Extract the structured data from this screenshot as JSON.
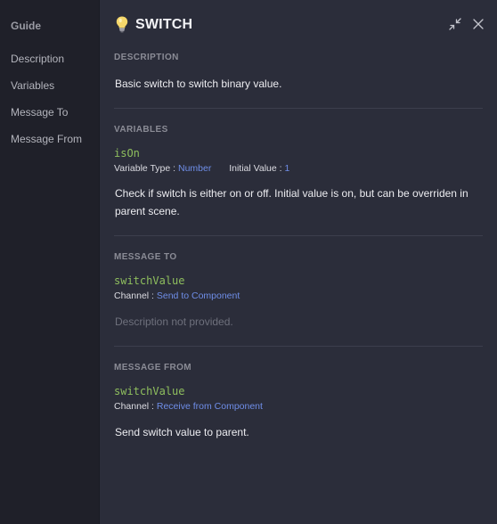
{
  "sidebar": {
    "title": "Guide",
    "items": [
      {
        "label": "Description"
      },
      {
        "label": "Variables"
      },
      {
        "label": "Message To"
      },
      {
        "label": "Message From"
      }
    ]
  },
  "header": {
    "title": "SWITCH",
    "icon": "lightbulb-icon",
    "actions": [
      "collapse-icon",
      "close-icon"
    ]
  },
  "description": {
    "heading": "DESCRIPTION",
    "text": "Basic switch to switch binary value."
  },
  "variables": {
    "heading": "VARIABLES",
    "items": [
      {
        "name": "isOn",
        "type_label": "Variable Type : ",
        "type": "Number",
        "initial_label": "Initial Value : ",
        "initial": "1",
        "text": "Check if switch is either on or off. Initial value is on, but can be overriden in parent scene."
      }
    ]
  },
  "message_to": {
    "heading": "MESSAGE TO",
    "items": [
      {
        "name": "switchValue",
        "channel_label": "Channel : ",
        "channel": "Send to Component",
        "text": "Description not provided."
      }
    ]
  },
  "message_from": {
    "heading": "MESSAGE FROM",
    "items": [
      {
        "name": "switchValue",
        "channel_label": "Channel : ",
        "channel": "Receive from Component",
        "text": "Send switch value to parent."
      }
    ]
  },
  "colors": {
    "background": "#2b2d3a",
    "sidebar": "#1f2029",
    "code": "#8fbf5e",
    "link": "#6f8ee8",
    "heading": "#8b8c96"
  }
}
